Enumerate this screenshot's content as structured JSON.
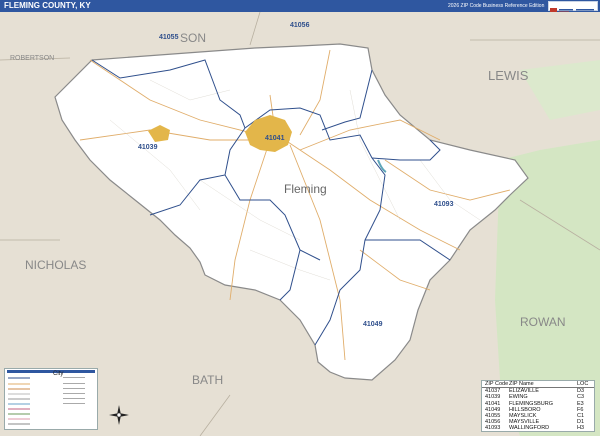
{
  "header": {
    "title": "FLEMING COUNTY, KY",
    "edition": "2026 ZIP Code Business Reference Edition"
  },
  "map": {
    "colors": {
      "background": "#e6e0d4",
      "county_fill": "#ffffff",
      "forest": "#d4e6c3",
      "urban": "#e3b64a",
      "zip_boundary": "#2f4f8c",
      "roads": "#e0ad6a",
      "title_bar": "#2f57a0"
    },
    "labels": {
      "county": "Fleming",
      "neighbor_mason": "SON",
      "neighbor_lewis": "LEWIS",
      "neighbor_robertson": "ROBERTSON",
      "neighbor_nicholas": "NICHOLAS",
      "neighbor_bath": "BATH",
      "neighbor_rowan": "ROWAN"
    },
    "zips": {
      "z41056": "41056",
      "z41055": "41055",
      "z41039": "41039",
      "z41041": "41041",
      "z41093": "41093",
      "z41049": "41049"
    }
  },
  "legend": {
    "city_label": "City"
  },
  "zip_table": {
    "headers": [
      "ZIP Code",
      "ZIP Name",
      "LOC"
    ],
    "rows": [
      {
        "zip": "41037",
        "name": "ELIZAVILLE",
        "loc": "D3"
      },
      {
        "zip": "41039",
        "name": "EWING",
        "loc": "C3"
      },
      {
        "zip": "41041",
        "name": "FLEMINGSBURG",
        "loc": "E3"
      },
      {
        "zip": "41049",
        "name": "HILLSBORO",
        "loc": "F6"
      },
      {
        "zip": "41055",
        "name": "MAYSLICK",
        "loc": "C1"
      },
      {
        "zip": "41056",
        "name": "MAYSVILLE",
        "loc": "D1"
      },
      {
        "zip": "41093",
        "name": "WALLINGFORD",
        "loc": "H3"
      }
    ]
  }
}
